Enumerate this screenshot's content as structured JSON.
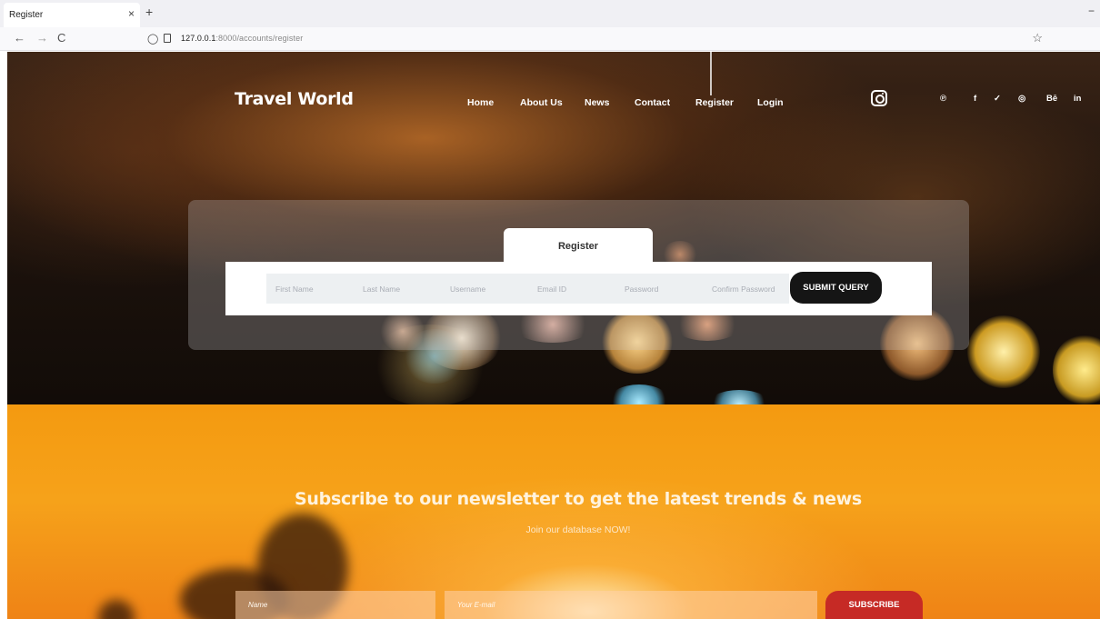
{
  "browser": {
    "tab_title": "Register",
    "tab_close": "×",
    "new_tab": "+",
    "minimize": "−",
    "back": "←",
    "forward": "→",
    "reload": "C",
    "shield": "◯",
    "url_host": "127.0.0.1",
    "url_path": ":8000/accounts/register",
    "bookmark": "☆"
  },
  "site": {
    "logo": "Travel World",
    "menu": [
      "Home",
      "About Us",
      "News",
      "Contact",
      "Register",
      "Login"
    ],
    "social": [
      "℗",
      "f",
      "✓",
      "◎",
      "Bē",
      "in"
    ]
  },
  "register": {
    "tab_label": "Register",
    "fields": [
      "First Name",
      "Last Name",
      "Username",
      "Email ID",
      "Password",
      "Confirm Password"
    ],
    "submit": "SUBMIT QUERY"
  },
  "newsletter": {
    "title": "Subscribe to our newsletter to get the latest trends & news",
    "subtitle": "Join our database NOW!",
    "name_placeholder": "Name",
    "email_placeholder": "Your E-mail",
    "button": "SUBSCRIBE"
  }
}
